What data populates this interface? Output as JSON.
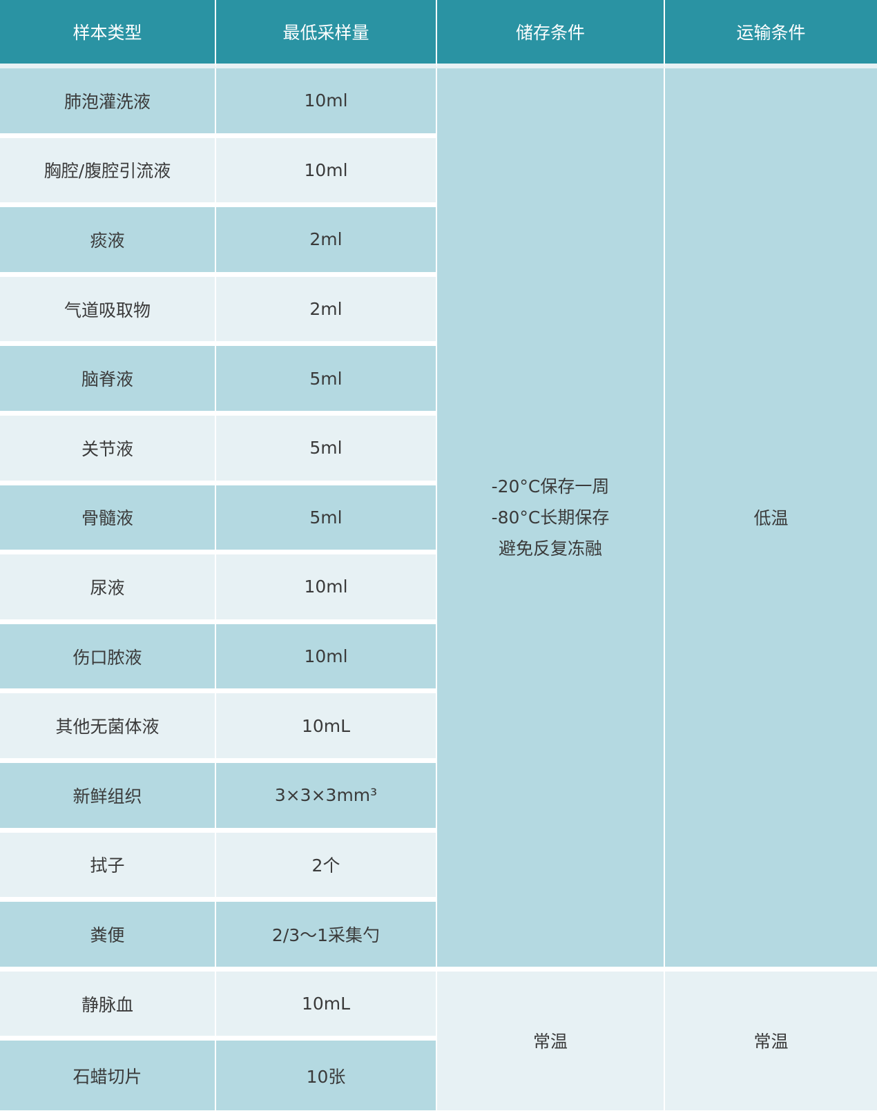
{
  "headers": [
    "样本类型",
    "最低采样量",
    "储存条件",
    "运输条件"
  ],
  "rows": [
    {
      "type": "肺泡灌洗液",
      "amount": "10ml"
    },
    {
      "type": "胸腔/腹腔引流液",
      "amount": "10ml"
    },
    {
      "type": "痰液",
      "amount": "2ml"
    },
    {
      "type": "气道吸取物",
      "amount": "2ml"
    },
    {
      "type": "脑脊液",
      "amount": "5ml"
    },
    {
      "type": "关节液",
      "amount": "5ml"
    },
    {
      "type": "骨髓液",
      "amount": "5ml"
    },
    {
      "type": "尿液",
      "amount": "10ml"
    },
    {
      "type": "伤口脓液",
      "amount": "10ml"
    },
    {
      "type": "其他无菌体液",
      "amount": "10mL"
    },
    {
      "type": "新鲜组织",
      "amount": "3×3×3mm³"
    },
    {
      "type": "拭子",
      "amount": "2个"
    },
    {
      "type": "粪便",
      "amount": "2/3～1采集勺"
    },
    {
      "type": "静脉血",
      "amount": "10mL"
    },
    {
      "type": "石蜡切片",
      "amount": "10张"
    }
  ],
  "group1": {
    "storage": [
      "-20°C保存一周",
      "-80°C长期保存",
      "避免反复冻融"
    ],
    "transport": "低温"
  },
  "group2": {
    "storage": "常温",
    "transport": "常温"
  },
  "colors": {
    "header": "#2a93a3",
    "dark_row": "#b4d9e1",
    "light_row": "#e7f1f4"
  }
}
